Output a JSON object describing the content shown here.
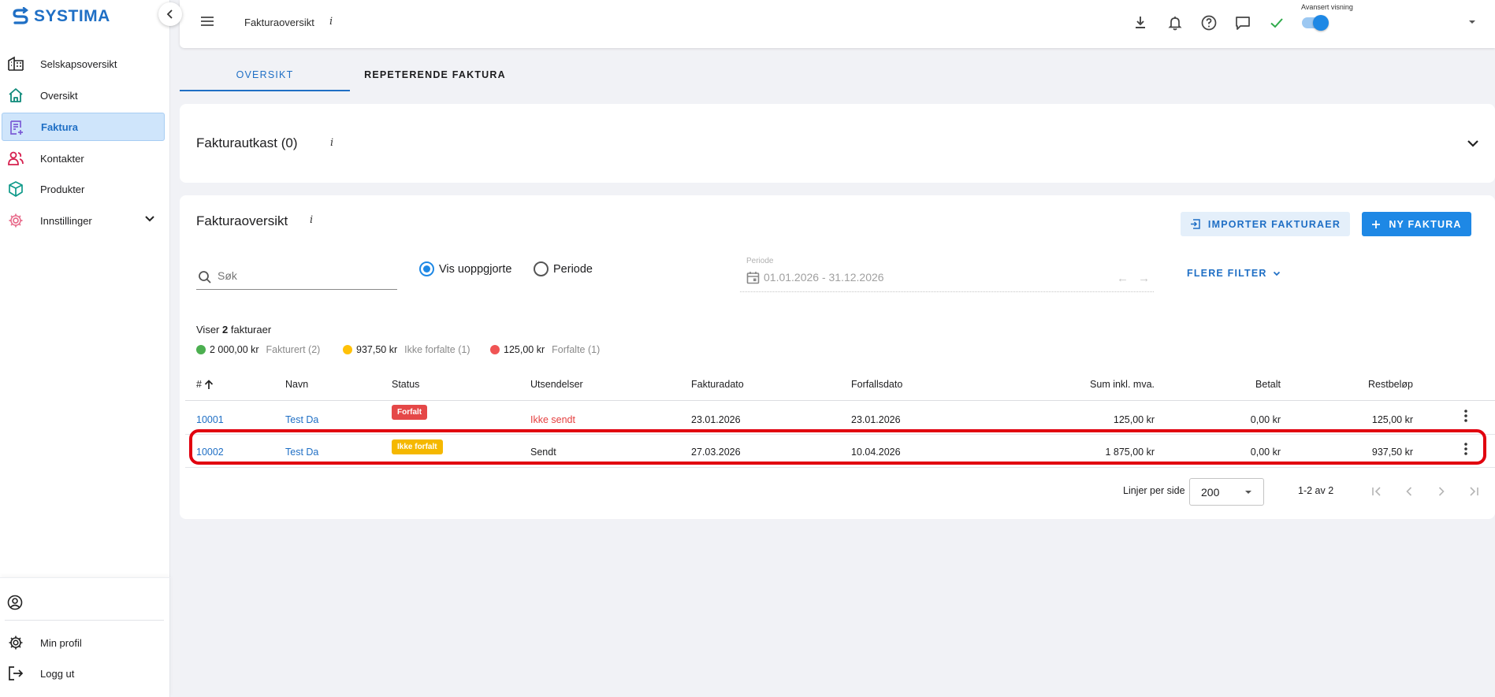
{
  "sidebar": {
    "logo": "SYSTIMA",
    "items": [
      {
        "label": "Selskapsoversikt",
        "icon": "company-building-icon"
      },
      {
        "label": "Oversikt",
        "icon": "home-icon"
      },
      {
        "label": "Faktura",
        "icon": "invoice-icon"
      },
      {
        "label": "Kontakter",
        "icon": "contacts-icon"
      },
      {
        "label": "Produkter",
        "icon": "product-box-icon"
      },
      {
        "label": "Innstillinger",
        "icon": "settings-gear-icon"
      }
    ],
    "bottom": {
      "profile_label": "Min profil",
      "logout_label": "Logg ut"
    }
  },
  "topbar": {
    "title": "Fakturaoversikt",
    "info": "i",
    "advanced_label": "Avansert visning",
    "advanced_on": true
  },
  "tabs": [
    {
      "label": "OVERSIKT",
      "active": true
    },
    {
      "label": "REPETERENDE FAKTURA",
      "active": false
    }
  ],
  "drafts": {
    "title": "Fakturautkast (0)",
    "info": "i"
  },
  "overview": {
    "title": "Fakturaoversikt",
    "info": "i",
    "import_button": "IMPORTER FAKTURAER",
    "new_button": "NY FAKTURA",
    "search_placeholder": "Søk",
    "radio_unsettled": "Vis uoppgjorte",
    "radio_period": "Periode",
    "period_label": "Periode",
    "period_value": "01.01.2026 - 31.12.2026",
    "more_filters": "FLERE FILTER",
    "showing_prefix": "Viser",
    "showing_count": "2",
    "showing_suffix": "fakturaer",
    "summary": [
      {
        "amount": "2 000,00 kr",
        "label": "Fakturert (2)",
        "color": "#4caf50"
      },
      {
        "amount": "937,50 kr",
        "label": "Ikke forfalte (1)",
        "color": "#ffc107"
      },
      {
        "amount": "125,00 kr",
        "label": "Forfalte (1)",
        "color": "#f05454"
      }
    ],
    "columns": [
      "#",
      "Navn",
      "Status",
      "Utsendelser",
      "Fakturadato",
      "Forfallsdato",
      "Sum inkl. mva.",
      "Betalt",
      "Restbeløp"
    ],
    "rows": [
      {
        "number": "10001",
        "name": "Test Da",
        "status": "Forfalt",
        "status_color": "#e54848",
        "sent": "Ikke sendt",
        "invoice_date": "23.01.2026",
        "due_date": "23.01.2026",
        "sum": "125,00 kr",
        "paid": "0,00 kr",
        "remaining": "125,00 kr"
      },
      {
        "number": "10002",
        "name": "Test Da",
        "status": "Ikke forfalt",
        "status_color": "#f5b800",
        "sent": "Sendt",
        "invoice_date": "27.03.2026",
        "due_date": "10.04.2026",
        "sum": "1 875,00 kr",
        "paid": "0,00 kr",
        "remaining": "937,50 kr"
      }
    ],
    "pagination": {
      "rows_per_page_label": "Linjer per side",
      "rows_per_page": "200",
      "range": "1-2 av 2"
    }
  },
  "colors": {
    "accent": "#1e88e5",
    "highlight": "#e1000f"
  }
}
